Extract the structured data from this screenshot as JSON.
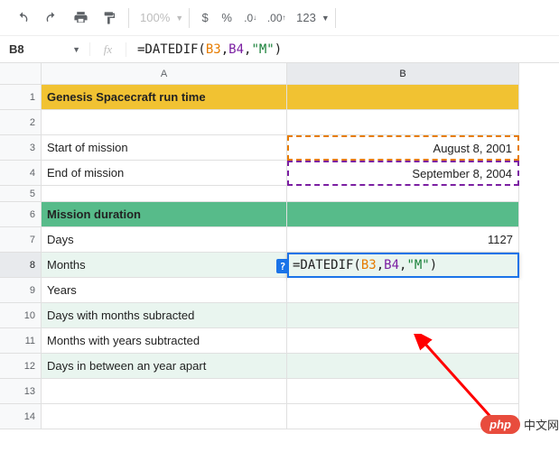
{
  "toolbar": {
    "zoom": "100%",
    "numfmt": "123"
  },
  "namebox": "B8",
  "formula": {
    "raw": "=DATEDIF(B3, B4,\"M\")",
    "parts": {
      "prefix": "=DATEDIF(",
      "ref1": "B3",
      "sep1": ", ",
      "ref2": "B4",
      "sep2": ",",
      "str": "\"M\"",
      "suffix": ")"
    }
  },
  "columns": [
    "A",
    "B"
  ],
  "row_numbers": [
    1,
    2,
    3,
    4,
    5,
    6,
    7,
    8,
    9,
    10,
    11,
    12,
    13,
    14
  ],
  "cells": {
    "A1": "Genesis Spacecraft run time",
    "A3": "Start of mission",
    "B3": "August 8, 2001",
    "A4": "End of mission",
    "B4": "September 8, 2004",
    "A6": "Mission duration",
    "A7": "Days",
    "B7": "1127",
    "A8": "Months",
    "A9": "Years",
    "A10": "Days with months subracted",
    "A11": "Months with years subtracted",
    "A12": "Days in between an year apart"
  },
  "help_chip": "?",
  "watermark": {
    "logo": "php",
    "text": "中文网"
  }
}
